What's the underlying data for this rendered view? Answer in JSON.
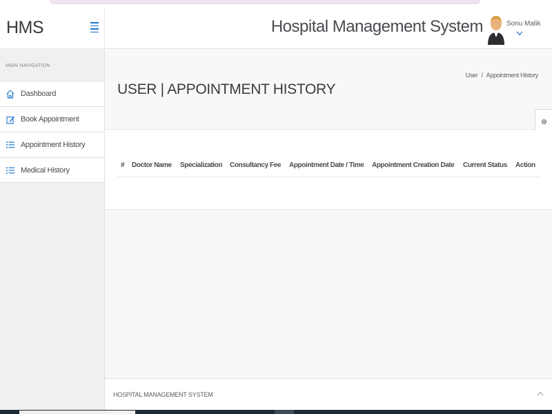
{
  "header": {
    "brand": "HMS",
    "app_title": "Hospital Management System",
    "user_name": "Sonu Malik",
    "user_menu_icon": "chevron-down-icon",
    "menu_icon": "hamburger-icon"
  },
  "sidebar": {
    "heading": "MAIN NAVIGATION",
    "items": [
      {
        "label": "Dashboard",
        "icon": "home-icon"
      },
      {
        "label": "Book Appointment",
        "icon": "pencil-square-icon"
      },
      {
        "label": "Appointment History",
        "icon": "list-icon"
      },
      {
        "label": "Medical History",
        "icon": "list-icon"
      }
    ]
  },
  "page": {
    "title": "USER | APPOINTMENT HISTORY",
    "breadcrumb": [
      "User",
      "Appointment History"
    ],
    "breadcrumb_separator": "/"
  },
  "table": {
    "columns": [
      "#",
      "Doctor Name",
      "Specialization",
      "Consultancy Fee",
      "Appointment Date / Time",
      "Appointment Creation Date",
      "Current Status",
      "Action"
    ],
    "rows": []
  },
  "footer": {
    "text": "HOSPITAL MANAGEMENT SYSTEM",
    "scroll_top_icon": "chevron-up-icon"
  },
  "colors": {
    "accent": "#1a73c8",
    "sidebar_bg": "#f0f0f2",
    "content_bg": "#f8f8f8"
  }
}
